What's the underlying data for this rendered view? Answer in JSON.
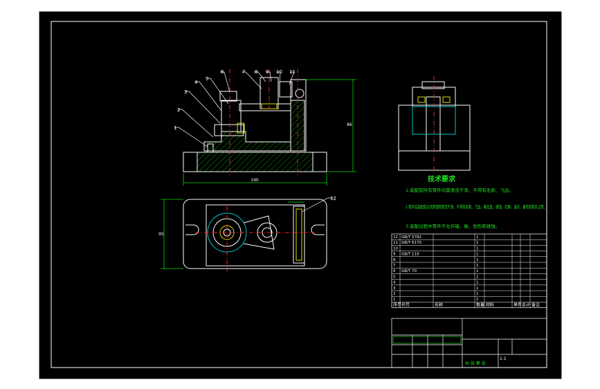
{
  "colors": {
    "background": "#000000",
    "frame": "#ffffff",
    "part": "#ffffff",
    "hatch": "#00a000",
    "centerline": "#ff2020",
    "dimension": "#00e000",
    "accent": "#00c8c8",
    "text_notes": "#20e020",
    "table_text": "#ffffff"
  },
  "balloons": [
    "1",
    "2",
    "3",
    "4",
    "5",
    "6",
    "7",
    "8",
    "9",
    "10",
    "11",
    "12"
  ],
  "dimensions": {
    "front_width": "190",
    "front_height": "86",
    "top_depth": "95"
  },
  "notes": {
    "title": "技术要求",
    "lines": [
      "1.装配前所有零件均需清洗干净，不得有毛刺、飞边。",
      "2.零件在装配前必须清理和清洗干净，不得有毛刺、飞边、氧化皮、锈蚀、切屑、油污、着色剂和灰尘等。",
      "3.装配过程中零件不允许磕、碰、划伤和锈蚀。"
    ]
  },
  "bom": {
    "headers": [
      "序号",
      "代号",
      "名称",
      "数量",
      "材料",
      "单件",
      "总计",
      "备注"
    ],
    "rows": [
      [
        "12",
        "GB/T 5782",
        "",
        "1",
        "",
        "",
        "",
        ""
      ],
      [
        "11",
        "GB/T 6170",
        "",
        "1",
        "",
        "",
        "",
        ""
      ],
      [
        "10",
        "",
        "",
        "1",
        "",
        "",
        "",
        ""
      ],
      [
        "9",
        "GB/T 119",
        "",
        "1",
        "",
        "",
        "",
        ""
      ],
      [
        "8",
        "",
        "",
        "1",
        "",
        "",
        "",
        ""
      ],
      [
        "7",
        "",
        "",
        "1",
        "",
        "",
        "",
        ""
      ],
      [
        "6",
        "GB/T 70",
        "",
        "1",
        "",
        "",
        "",
        ""
      ],
      [
        "5",
        "",
        "",
        "1",
        "",
        "",
        "",
        ""
      ],
      [
        "4",
        "",
        "",
        "1",
        "",
        "",
        "",
        ""
      ],
      [
        "3",
        "",
        "",
        "1",
        "",
        "",
        "",
        ""
      ],
      [
        "2",
        "",
        "",
        "1",
        "",
        "",
        "",
        ""
      ],
      [
        "1",
        "",
        "",
        "1",
        "",
        "",
        "",
        ""
      ]
    ]
  },
  "title_block": {
    "scale": "1:1",
    "sheet": "共 张 第 张"
  }
}
